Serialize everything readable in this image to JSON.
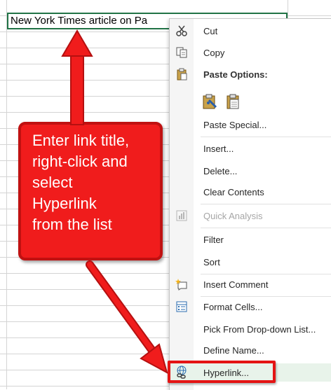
{
  "cell": {
    "value": "New York Times article on Pa"
  },
  "menu": {
    "cut": "Cut",
    "copy": "Copy",
    "paste_options": "Paste Options:",
    "paste_special": "Paste Special...",
    "insert": "Insert...",
    "delete": "Delete...",
    "clear_contents": "Clear Contents",
    "quick_analysis": "Quick Analysis",
    "filter": "Filter",
    "sort": "Sort",
    "insert_comment": "Insert Comment",
    "format_cells": "Format Cells...",
    "pick_from_dropdown": "Pick From Drop-down List...",
    "define_name": "Define Name...",
    "hyperlink": "Hyperlink..."
  },
  "callout": {
    "lines": [
      "Enter link title,",
      "right-click and",
      "select",
      "Hyperlink",
      "from the list"
    ]
  },
  "colors": {
    "accent_red": "#f01c1c",
    "excel_green": "#217346",
    "hover": "#e8f3ea"
  }
}
